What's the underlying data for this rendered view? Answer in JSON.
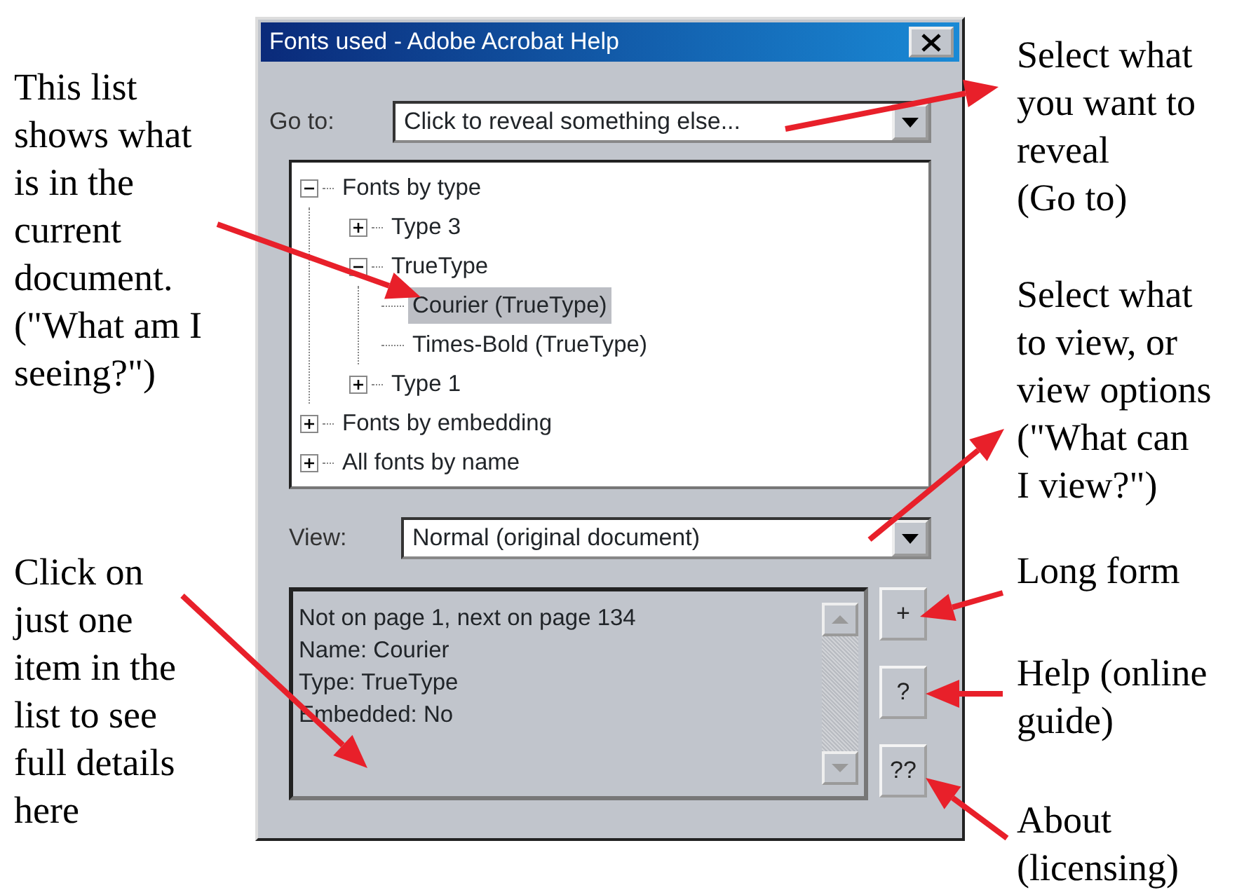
{
  "dialog": {
    "title": "Fonts used - Adobe Acrobat Help",
    "goto": {
      "label": "Go to:",
      "value": "Click to reveal something else..."
    },
    "tree": [
      {
        "label": "Fonts by type",
        "expanded": true,
        "selected": false,
        "children": [
          {
            "label": "Type 3",
            "expanded": false,
            "selected": false
          },
          {
            "label": "TrueType",
            "expanded": true,
            "selected": false,
            "children": [
              {
                "label": "Courier (TrueType)",
                "selected": true
              },
              {
                "label": "Times-Bold (TrueType)",
                "selected": false
              }
            ]
          },
          {
            "label": "Type 1",
            "expanded": false,
            "selected": false
          }
        ]
      },
      {
        "label": "Fonts by embedding",
        "expanded": false,
        "selected": false
      },
      {
        "label": "All fonts by name",
        "expanded": false,
        "selected": false
      }
    ],
    "view": {
      "label": "View:",
      "value": "Normal (original document)"
    },
    "details": [
      "Not on page 1, next on page 134",
      "Name: Courier",
      "Type: TrueType",
      "Embedded: No"
    ],
    "buttons": [
      "+",
      "?",
      "??"
    ]
  },
  "annotations_left": [
    "This list\nshows what\nis in the\ncurrent\ndocument.\n(\"What am I\nseeing?\")",
    "Click on\njust one\nitem in the\nlist to see\nfull details\nhere"
  ],
  "annotations_right": [
    "Select what\nyou want to\nreveal\n(Go to)",
    "Select what\nto view, or\nview options\n(\"What can\nI view?\")",
    "Long form",
    "Help (online\nguide)",
    "About\n(licensing)"
  ]
}
